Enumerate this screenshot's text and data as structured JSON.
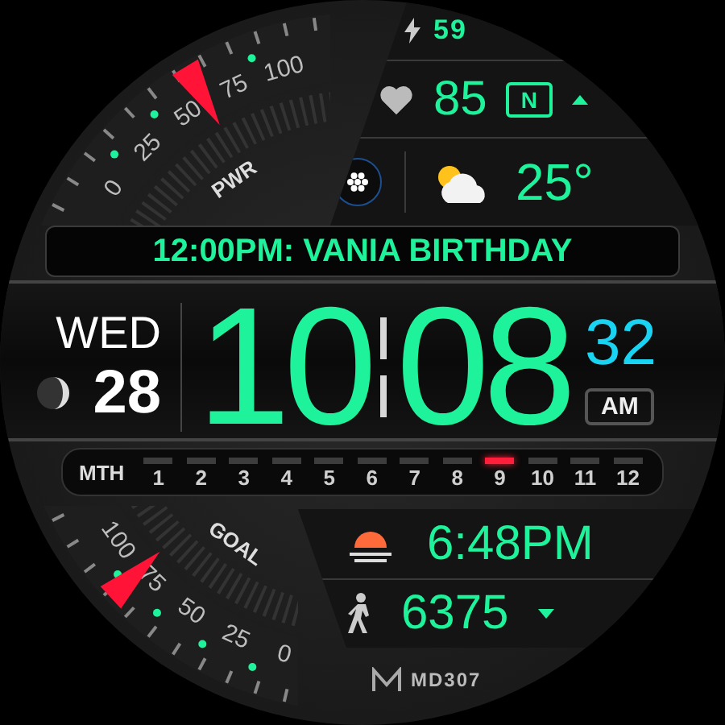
{
  "battery_gauge": {
    "label": "PWR",
    "scale": [
      "0",
      "25",
      "50",
      "75",
      "100"
    ]
  },
  "status": {
    "charge": "59",
    "heart_rate": "85",
    "badge": "N"
  },
  "weather": {
    "temperature": "25°"
  },
  "event": {
    "text": "12:00PM: VANIA BIRTHDAY"
  },
  "date": {
    "weekday": "WED",
    "day": "28"
  },
  "time": {
    "hour": "10",
    "minute": "08",
    "second": "32",
    "period": "AM"
  },
  "month_strip": {
    "label": "MTH",
    "months": [
      {
        "label": "1",
        "selected": false
      },
      {
        "label": "2",
        "selected": false
      },
      {
        "label": "3",
        "selected": false
      },
      {
        "label": "4",
        "selected": false
      },
      {
        "label": "5",
        "selected": false
      },
      {
        "label": "6",
        "selected": false
      },
      {
        "label": "7",
        "selected": false
      },
      {
        "label": "8",
        "selected": false
      },
      {
        "label": "9",
        "selected": true
      },
      {
        "label": "10",
        "selected": false
      },
      {
        "label": "11",
        "selected": false
      },
      {
        "label": "12",
        "selected": false
      }
    ]
  },
  "goal_gauge": {
    "label": "GOAL",
    "scale": [
      "100",
      "75",
      "50",
      "25",
      "0"
    ]
  },
  "sunset": {
    "time": "6:48PM"
  },
  "steps": {
    "count": "6375"
  },
  "brand": {
    "name": "MD307"
  }
}
